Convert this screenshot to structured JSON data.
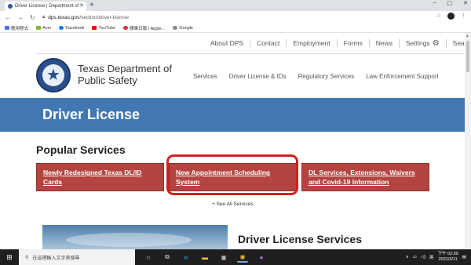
{
  "browser": {
    "tab_title": "Driver License | Department of",
    "new_tab": "+",
    "url_domain": "dps.texas.gov",
    "url_path": "/section/driver-license",
    "window_controls": [
      "–",
      "▢",
      "✕"
    ],
    "bookmarks": [
      {
        "label": "應用程式",
        "color": "#4a77d4"
      },
      {
        "label": "Acer",
        "color": "#83b735"
      },
      {
        "label": "Facebook",
        "color": "#1877f2"
      },
      {
        "label": "YouTube",
        "color": "#ff0000"
      },
      {
        "label": "蘋果日報 | Apple...",
        "color": "#d0312d"
      },
      {
        "label": "Google",
        "color": "#888888"
      }
    ]
  },
  "utility_nav": {
    "items": [
      "About DPS",
      "Contact",
      "Employment",
      "Forms",
      "News",
      "Settings",
      "Search"
    ]
  },
  "header": {
    "org_name": "Texas Department of Public Safety",
    "main_nav": [
      "Services",
      "Driver License & IDs",
      "Regulatory Services",
      "Law Enforcement Support"
    ]
  },
  "banner": {
    "title": "Driver License"
  },
  "popular": {
    "heading": "Popular Services",
    "cards": [
      "Newly Redesigned Texas DL/ID Cards",
      "New Appointment Scheduling System",
      "DL Services, Extensions, Waivers and Covid-19 Information"
    ],
    "see_all": "+ See All Services"
  },
  "dl_services": {
    "heading": "Driver License Services"
  },
  "taskbar": {
    "search_placeholder": "在這裡輸入文字來搜尋",
    "ime": "英",
    "time": "下午 02:39",
    "date": "2021/3/11"
  },
  "colors": {
    "banner": "#4178b4",
    "card": "#b3443f",
    "highlight": "#d41f1f"
  }
}
